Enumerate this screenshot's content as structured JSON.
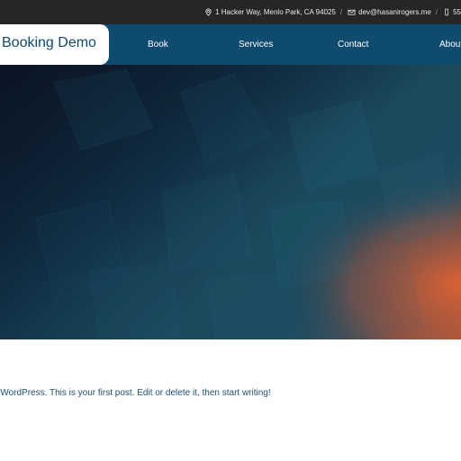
{
  "topbar": {
    "address": "1 Hacker Way, Menlo Park, CA 94025",
    "address_icon": "location-pin-icon",
    "email": "dev@hasanirogers.me",
    "email_icon": "envelope-icon",
    "phone_partial": "55",
    "phone_icon": "mobile-phone-icon",
    "separator": "/"
  },
  "header": {
    "site_title": "Booking Demo",
    "nav": [
      {
        "label": "Book"
      },
      {
        "label": "Services"
      },
      {
        "label": "Contact"
      },
      {
        "label": "About"
      }
    ]
  },
  "colors": {
    "topbar_bg": "#262626",
    "nav_bg": "#0f4a6f",
    "accent_orange": "#d65f35",
    "text_blue": "#1d4f73"
  },
  "content": {
    "post_excerpt": "o WordPress. This is your first post. Edit or delete it, then start writing!"
  }
}
